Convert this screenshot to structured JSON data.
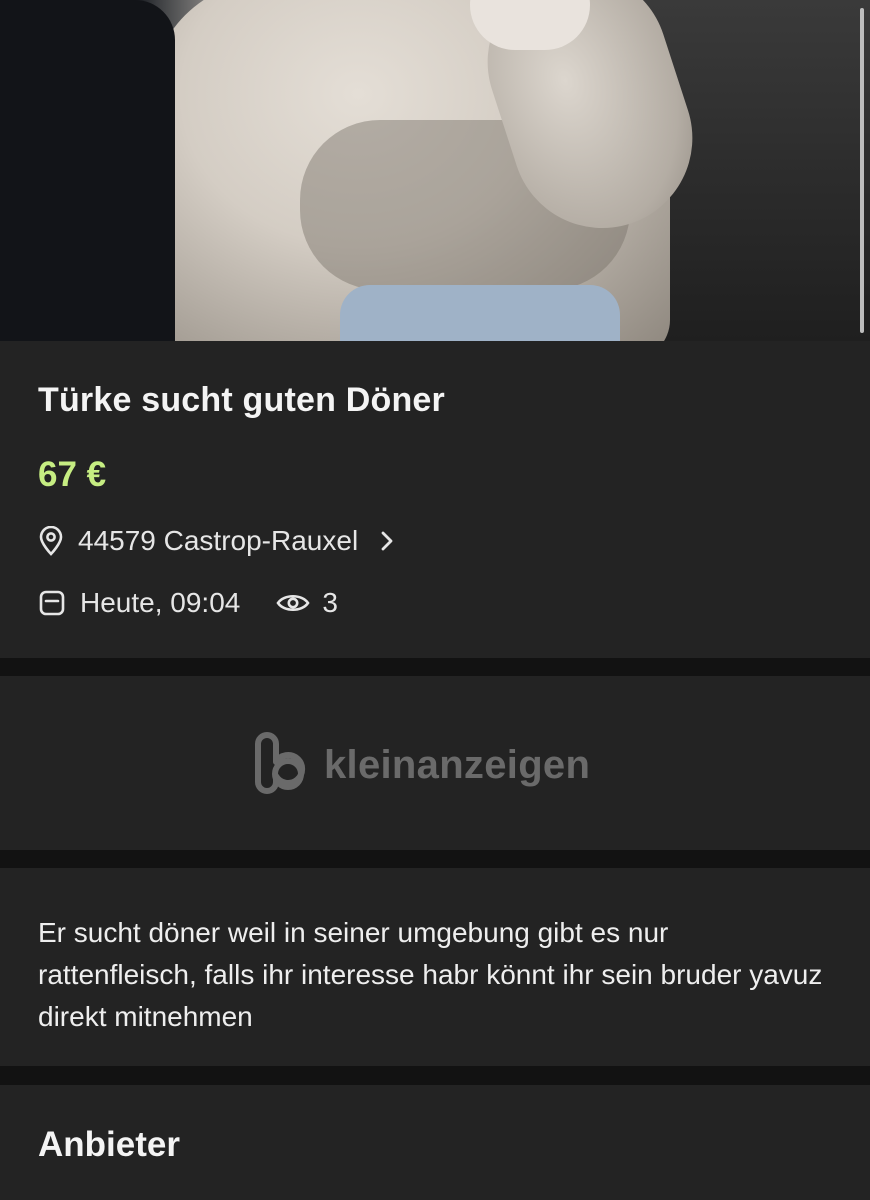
{
  "listing": {
    "title": "Türke sucht guten Döner",
    "price": "67 €",
    "location": "44579 Castrop-Rauxel",
    "date": "Heute, 09:04",
    "views": "3",
    "description": "Er sucht döner weil in seiner umgebung gibt es nur rattenfleisch, falls ihr interesse habr könnt ihr sein bruder yavuz direkt mitnehmen"
  },
  "brand": {
    "name": "kleinanzeigen",
    "icon": "kleinanzeigen-logo-icon"
  },
  "seller": {
    "heading": "Anbieter"
  },
  "icons": {
    "location": "location-pin-icon",
    "chevron": "chevron-right-icon",
    "date": "calendar-icon",
    "views": "eye-icon"
  },
  "colors": {
    "price": "#c6ed82",
    "background": "#121212",
    "card": "#232323"
  }
}
